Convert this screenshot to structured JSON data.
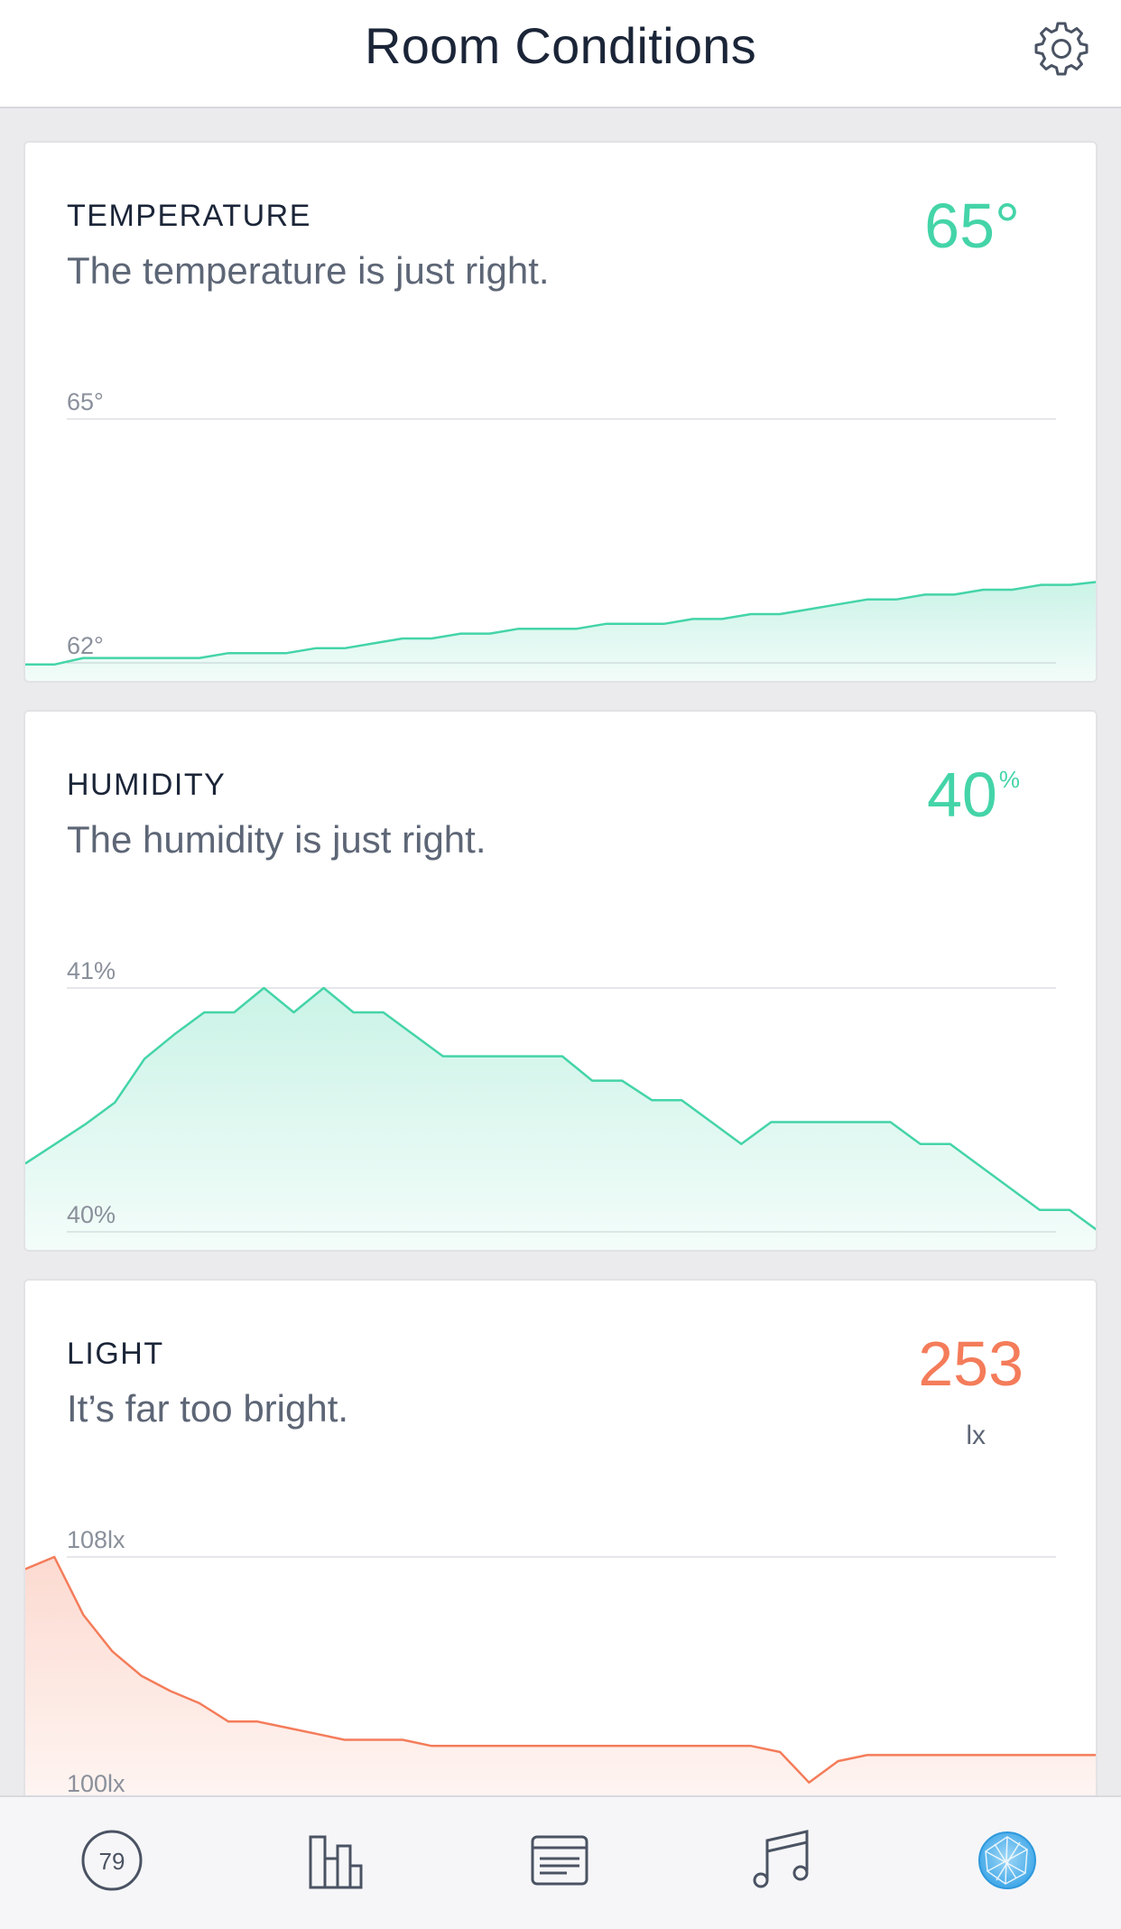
{
  "header": {
    "title": "Room Conditions",
    "settings_icon": "gear-icon"
  },
  "colors": {
    "good": "#44d4a8",
    "bad": "#f47c5a",
    "text_dark": "#1b2538",
    "text_muted": "#5d6676"
  },
  "cards": [
    {
      "id": "temperature",
      "label": "TEMPERATURE",
      "description": "The temperature is just right.",
      "value": "65°",
      "status": "good",
      "chart_data": {
        "type": "area",
        "y_max_label": "65°",
        "y_min_label": "62°",
        "ylim": [
          62,
          65
        ],
        "values": [
          61.98,
          61.98,
          62.06,
          62.06,
          62.06,
          62.06,
          62.06,
          62.12,
          62.12,
          62.12,
          62.18,
          62.18,
          62.24,
          62.3,
          62.3,
          62.36,
          62.36,
          62.42,
          62.42,
          62.42,
          62.48,
          62.48,
          62.48,
          62.54,
          62.54,
          62.6,
          62.6,
          62.66,
          62.72,
          62.78,
          62.78,
          62.84,
          62.84,
          62.9,
          62.9,
          62.96,
          62.96,
          63.0
        ]
      }
    },
    {
      "id": "humidity",
      "label": "HUMIDITY",
      "description": "The humidity is just right.",
      "value": "40",
      "value_unit": "%",
      "status": "good",
      "chart_data": {
        "type": "area",
        "y_max_label": "41%",
        "y_min_label": "40%",
        "ylim": [
          40,
          41
        ],
        "values": [
          40.28,
          40.36,
          40.44,
          40.53,
          40.71,
          40.81,
          40.9,
          40.9,
          41.0,
          40.9,
          41.0,
          40.9,
          40.9,
          40.81,
          40.72,
          40.72,
          40.72,
          40.72,
          40.72,
          40.62,
          40.62,
          40.54,
          40.54,
          40.45,
          40.36,
          40.45,
          40.45,
          40.45,
          40.45,
          40.45,
          40.36,
          40.36,
          40.27,
          40.18,
          40.09,
          40.09,
          40.0
        ]
      }
    },
    {
      "id": "light",
      "label": "LIGHT",
      "description": "It’s far too bright.",
      "value": "253",
      "value_unit_below": "lx",
      "status": "bad",
      "chart_data": {
        "type": "area",
        "y_max_label": "108lx",
        "y_min_label": "100lx",
        "ylim": [
          100,
          108
        ],
        "values": [
          107.6,
          108.0,
          106.1,
          104.9,
          104.1,
          103.6,
          103.2,
          102.6,
          102.6,
          102.4,
          102.2,
          102.0,
          102.0,
          102.0,
          101.8,
          101.8,
          101.8,
          101.8,
          101.8,
          101.8,
          101.8,
          101.8,
          101.8,
          101.8,
          101.8,
          101.8,
          101.6,
          100.6,
          101.3,
          101.5,
          101.5,
          101.5,
          101.5,
          101.5,
          101.5,
          101.5,
          101.5,
          101.5
        ]
      }
    }
  ],
  "tabbar": {
    "badge_count": "79",
    "tabs": [
      "score-badge-icon",
      "bar-chart-icon",
      "card-list-icon",
      "music-note-icon",
      "globe-sense-icon"
    ]
  }
}
